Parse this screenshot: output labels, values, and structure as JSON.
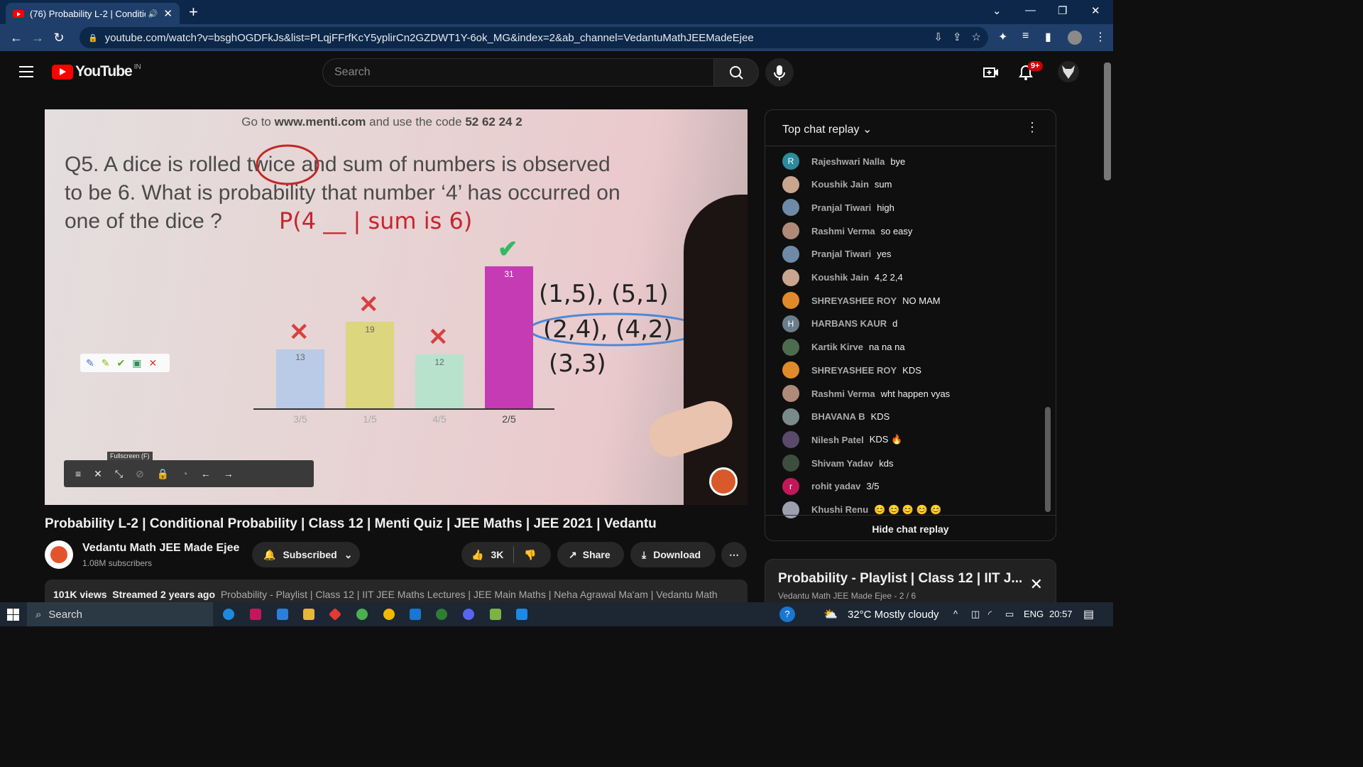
{
  "browser": {
    "tab_title": "(76) Probability L-2 | Conditio",
    "url": "youtube.com/watch?v=bsghOGDFkJs&list=PLqjFFrfKcY5yplirCn2GZDWT1Y-6ok_MG&index=2&ab_channel=VedantuMathJEEMadeEjee"
  },
  "youtube": {
    "logo": "YouTube",
    "region": "IN",
    "search_placeholder": "Search",
    "notif_count": "9+"
  },
  "video": {
    "menti_prefix": "Go to",
    "menti_site": "www.menti.com",
    "menti_mid": "and use the code",
    "menti_code": "52 62 24 2",
    "question_l1": "Q5. A dice is rolled twice and sum of numbers is observed",
    "question_l2": "to be 6. What is probability that number ‘4’ has occurred on",
    "question_l3": "one of the dice ?",
    "hand_p": "P(4 __ | sum is 6)",
    "hand_pairs1": "(1,5), (5,1)",
    "hand_pairs2": "(2,4), (4,2)",
    "hand_pairs3": "(3,3)",
    "fullscreen_tip": "Fullscreen (F)",
    "title": "Probability L-2 | Conditional Probability | Class 12 | Menti Quiz | JEE Maths | JEE 2021 | Vedantu"
  },
  "chart_data": {
    "type": "bar",
    "categories": [
      "3/5",
      "1/5",
      "4/5",
      "2/5"
    ],
    "values": [
      13,
      19,
      12,
      31
    ],
    "colors": [
      "#b9cbe6",
      "#dcd67e",
      "#b8e2cc",
      "#c53bb4"
    ],
    "correct": "2/5"
  },
  "channel": {
    "name": "Vedantu Math JEE Made Ejee",
    "subscribers": "1.08M subscribers",
    "subscribed": "Subscribed",
    "likes": "3K",
    "share": "Share",
    "download": "Download"
  },
  "description": {
    "views": "101K views",
    "streamed": "Streamed 2 years ago",
    "text": "Probability - Playlist | Class 12 | IIT JEE Maths Lectures | JEE Main Maths | Neha Agrawal Ma'am | Vedantu Math"
  },
  "chat": {
    "header": "Top chat replay",
    "footer": "Hide chat replay",
    "messages": [
      {
        "author": "Rajeshwari Nalla",
        "text": "bye",
        "initial": "R",
        "color": "#2c8a9e"
      },
      {
        "author": "Koushik Jain",
        "text": "sum",
        "initial": "",
        "color": "#c9a58f"
      },
      {
        "author": "Pranjal Tiwari",
        "text": "high",
        "initial": "",
        "color": "#6e8aa8"
      },
      {
        "author": "Rashmi Verma",
        "text": "so easy",
        "initial": "",
        "color": "#b08a78"
      },
      {
        "author": "Pranjal Tiwari",
        "text": "yes",
        "initial": "",
        "color": "#6e8aa8"
      },
      {
        "author": "Koushik Jain",
        "text": "4,2 2,4",
        "initial": "",
        "color": "#c9a58f"
      },
      {
        "author": "SHREYASHEE ROY",
        "text": "NO MAM",
        "initial": "",
        "color": "#e08a2a"
      },
      {
        "author": "HARBANS KAUR",
        "text": "d",
        "initial": "H",
        "color": "#6b7d8c"
      },
      {
        "author": "Kartik Kirve",
        "text": "na na na",
        "initial": "",
        "color": "#4d6b4f"
      },
      {
        "author": "SHREYASHEE ROY",
        "text": "KDS",
        "initial": "",
        "color": "#e08a2a"
      },
      {
        "author": "Rashmi Verma",
        "text": "wht happen vyas",
        "initial": "",
        "color": "#b08a78"
      },
      {
        "author": "BHAVANA B",
        "text": "KDS",
        "initial": "",
        "color": "#7a8a8a"
      },
      {
        "author": "Nilesh Patel",
        "text": "KDS 🔥",
        "initial": "",
        "color": "#5a4a6a"
      },
      {
        "author": "Shivam Yadav",
        "text": "kds",
        "initial": "",
        "color": "#3e4e3e"
      },
      {
        "author": "rohit yadav",
        "text": "3/5",
        "initial": "r",
        "color": "#c2185b"
      },
      {
        "author": "Khushi Renu",
        "text": "😊 😊 😊 😊 😊",
        "initial": "",
        "color": "#9aa0b0"
      }
    ]
  },
  "playlist": {
    "title": "Probability - Playlist | Class 12 | IIT J...",
    "sub": "Vedantu Math JEE Made Ejee - 2 / 6"
  },
  "taskbar": {
    "search": "Search",
    "weather": "32°C  Mostly cloudy",
    "lang": "ENG",
    "time": "20:57"
  }
}
